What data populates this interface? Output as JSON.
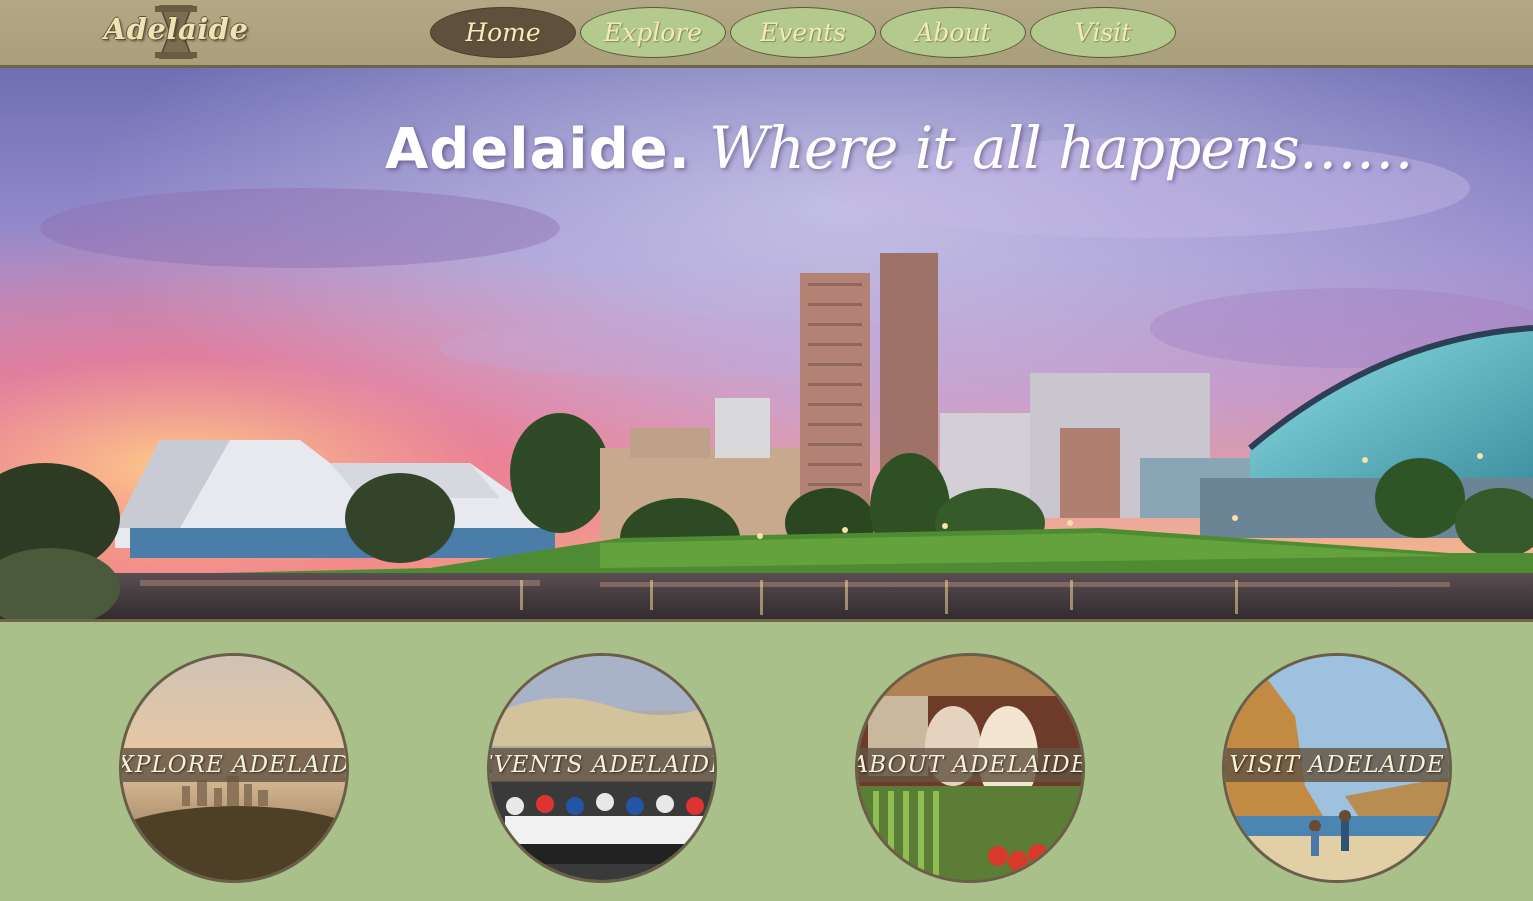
{
  "logo": {
    "text": "Adelaide"
  },
  "nav": {
    "items": [
      {
        "label": "Home",
        "active": true
      },
      {
        "label": "Explore",
        "active": false
      },
      {
        "label": "Events",
        "active": false
      },
      {
        "label": "About",
        "active": false
      },
      {
        "label": "Visit",
        "active": false
      }
    ]
  },
  "hero": {
    "title_strong": "Adelaide.",
    "title_script": "Where it all happens……"
  },
  "cards": [
    {
      "label": "EXPLORE ADELAIDE"
    },
    {
      "label": "EVENTS ADELAIDE"
    },
    {
      "label": "ABOUT ADELAIDE"
    },
    {
      "label": "VISIT ADELAIDE"
    }
  ],
  "colors": {
    "header_bg": "#b2a885",
    "nav_active": "#5f503b",
    "nav_inactive": "#b3c98d",
    "page_bg": "#a9c08a",
    "card_band": "#645442"
  }
}
